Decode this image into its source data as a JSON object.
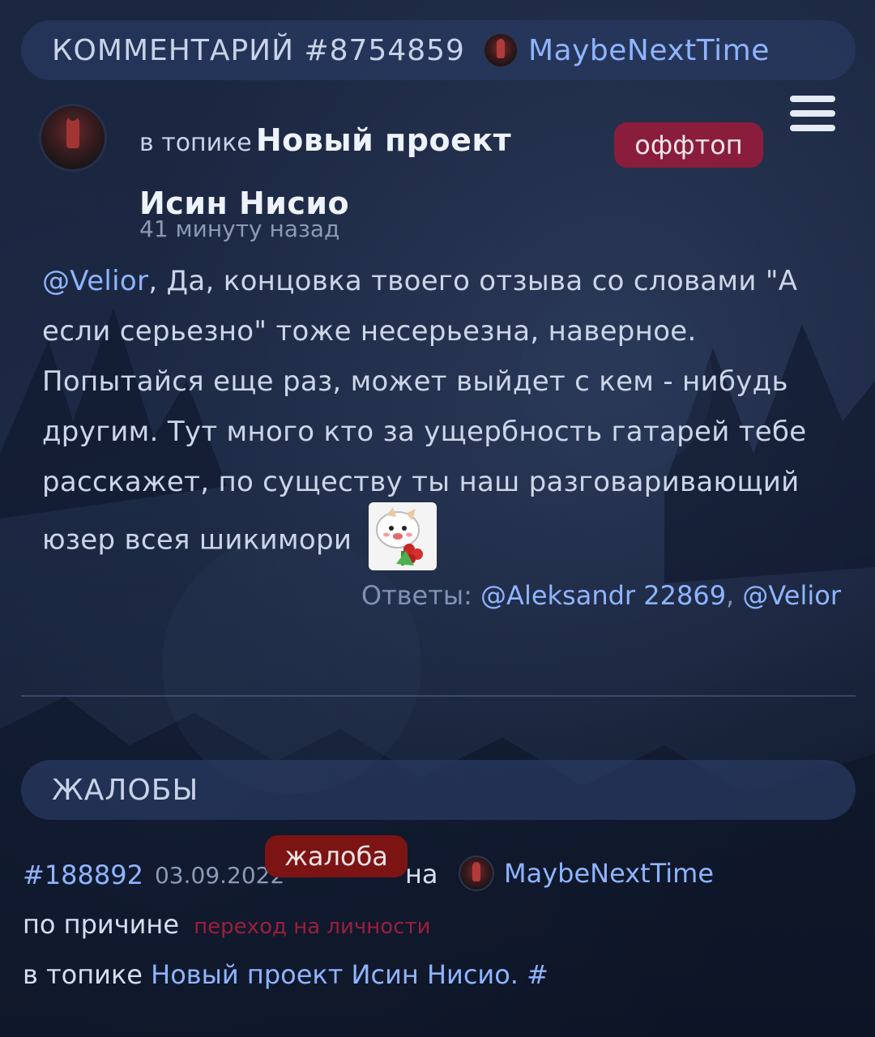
{
  "comment_header": {
    "title": "КОММЕНТАРИЙ #8754859",
    "author": "MaybeNextTime"
  },
  "comment": {
    "topic_prefix": "в топике",
    "topic_title": "Новый проект Исин Нисио",
    "badge": "оффтоп",
    "time": "41 минуту назад",
    "mention": "@Velior",
    "text": ", Да, концовка твоего отзыва со словами \"А если серьезно\" тоже несерьезна, наверное. Попытайся еще раз, может выйдет с кем - нибудь другим. Тут много кто за ущербность гатарей тебе расскажет, по существу ты наш разговаривающий юзер всея шикимори",
    "replies_label": "Ответы:",
    "replies": [
      "@Aleksandr 22869",
      "@Velior"
    ]
  },
  "complaints_header": {
    "title": "ЖАЛОБЫ"
  },
  "complaint": {
    "id": "#188892",
    "date": "03.09.2022",
    "badge": "жалоба",
    "on_label": "на",
    "user": "MaybeNextTime",
    "reason_label": "по причине",
    "reason": "переход на личности",
    "topic_prefix": "в топике",
    "topic_link": "Новый проект Исин Нисио.",
    "hash": "#"
  },
  "colors": {
    "link": "#8fb4ff",
    "offtop_badge": "#8a1d3c",
    "complaint_badge": "#7d1414",
    "reason": "#9b1f3b"
  },
  "icons": {
    "menu": "hamburger-menu-icon",
    "sticker": "sticker-icon"
  }
}
